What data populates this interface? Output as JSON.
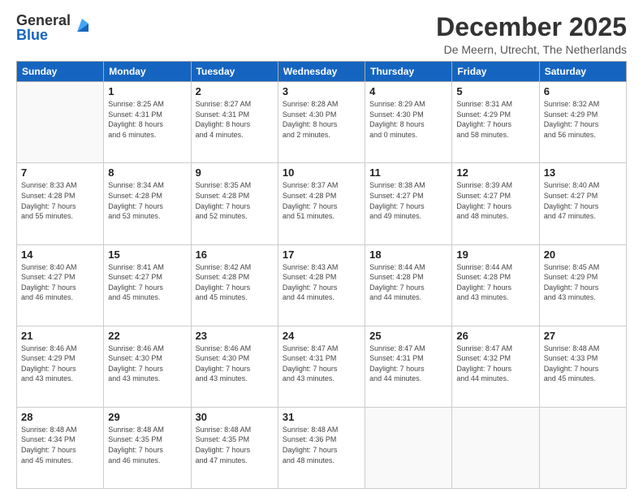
{
  "logo": {
    "general": "General",
    "blue": "Blue"
  },
  "title": "December 2025",
  "subtitle": "De Meern, Utrecht, The Netherlands",
  "days_of_week": [
    "Sunday",
    "Monday",
    "Tuesday",
    "Wednesday",
    "Thursday",
    "Friday",
    "Saturday"
  ],
  "weeks": [
    [
      {
        "day": "",
        "info": ""
      },
      {
        "day": "1",
        "info": "Sunrise: 8:25 AM\nSunset: 4:31 PM\nDaylight: 8 hours\nand 6 minutes."
      },
      {
        "day": "2",
        "info": "Sunrise: 8:27 AM\nSunset: 4:31 PM\nDaylight: 8 hours\nand 4 minutes."
      },
      {
        "day": "3",
        "info": "Sunrise: 8:28 AM\nSunset: 4:30 PM\nDaylight: 8 hours\nand 2 minutes."
      },
      {
        "day": "4",
        "info": "Sunrise: 8:29 AM\nSunset: 4:30 PM\nDaylight: 8 hours\nand 0 minutes."
      },
      {
        "day": "5",
        "info": "Sunrise: 8:31 AM\nSunset: 4:29 PM\nDaylight: 7 hours\nand 58 minutes."
      },
      {
        "day": "6",
        "info": "Sunrise: 8:32 AM\nSunset: 4:29 PM\nDaylight: 7 hours\nand 56 minutes."
      }
    ],
    [
      {
        "day": "7",
        "info": "Sunrise: 8:33 AM\nSunset: 4:28 PM\nDaylight: 7 hours\nand 55 minutes."
      },
      {
        "day": "8",
        "info": "Sunrise: 8:34 AM\nSunset: 4:28 PM\nDaylight: 7 hours\nand 53 minutes."
      },
      {
        "day": "9",
        "info": "Sunrise: 8:35 AM\nSunset: 4:28 PM\nDaylight: 7 hours\nand 52 minutes."
      },
      {
        "day": "10",
        "info": "Sunrise: 8:37 AM\nSunset: 4:28 PM\nDaylight: 7 hours\nand 51 minutes."
      },
      {
        "day": "11",
        "info": "Sunrise: 8:38 AM\nSunset: 4:27 PM\nDaylight: 7 hours\nand 49 minutes."
      },
      {
        "day": "12",
        "info": "Sunrise: 8:39 AM\nSunset: 4:27 PM\nDaylight: 7 hours\nand 48 minutes."
      },
      {
        "day": "13",
        "info": "Sunrise: 8:40 AM\nSunset: 4:27 PM\nDaylight: 7 hours\nand 47 minutes."
      }
    ],
    [
      {
        "day": "14",
        "info": "Sunrise: 8:40 AM\nSunset: 4:27 PM\nDaylight: 7 hours\nand 46 minutes."
      },
      {
        "day": "15",
        "info": "Sunrise: 8:41 AM\nSunset: 4:27 PM\nDaylight: 7 hours\nand 45 minutes."
      },
      {
        "day": "16",
        "info": "Sunrise: 8:42 AM\nSunset: 4:28 PM\nDaylight: 7 hours\nand 45 minutes."
      },
      {
        "day": "17",
        "info": "Sunrise: 8:43 AM\nSunset: 4:28 PM\nDaylight: 7 hours\nand 44 minutes."
      },
      {
        "day": "18",
        "info": "Sunrise: 8:44 AM\nSunset: 4:28 PM\nDaylight: 7 hours\nand 44 minutes."
      },
      {
        "day": "19",
        "info": "Sunrise: 8:44 AM\nSunset: 4:28 PM\nDaylight: 7 hours\nand 43 minutes."
      },
      {
        "day": "20",
        "info": "Sunrise: 8:45 AM\nSunset: 4:29 PM\nDaylight: 7 hours\nand 43 minutes."
      }
    ],
    [
      {
        "day": "21",
        "info": "Sunrise: 8:46 AM\nSunset: 4:29 PM\nDaylight: 7 hours\nand 43 minutes."
      },
      {
        "day": "22",
        "info": "Sunrise: 8:46 AM\nSunset: 4:30 PM\nDaylight: 7 hours\nand 43 minutes."
      },
      {
        "day": "23",
        "info": "Sunrise: 8:46 AM\nSunset: 4:30 PM\nDaylight: 7 hours\nand 43 minutes."
      },
      {
        "day": "24",
        "info": "Sunrise: 8:47 AM\nSunset: 4:31 PM\nDaylight: 7 hours\nand 43 minutes."
      },
      {
        "day": "25",
        "info": "Sunrise: 8:47 AM\nSunset: 4:31 PM\nDaylight: 7 hours\nand 44 minutes."
      },
      {
        "day": "26",
        "info": "Sunrise: 8:47 AM\nSunset: 4:32 PM\nDaylight: 7 hours\nand 44 minutes."
      },
      {
        "day": "27",
        "info": "Sunrise: 8:48 AM\nSunset: 4:33 PM\nDaylight: 7 hours\nand 45 minutes."
      }
    ],
    [
      {
        "day": "28",
        "info": "Sunrise: 8:48 AM\nSunset: 4:34 PM\nDaylight: 7 hours\nand 45 minutes."
      },
      {
        "day": "29",
        "info": "Sunrise: 8:48 AM\nSunset: 4:35 PM\nDaylight: 7 hours\nand 46 minutes."
      },
      {
        "day": "30",
        "info": "Sunrise: 8:48 AM\nSunset: 4:35 PM\nDaylight: 7 hours\nand 47 minutes."
      },
      {
        "day": "31",
        "info": "Sunrise: 8:48 AM\nSunset: 4:36 PM\nDaylight: 7 hours\nand 48 minutes."
      },
      {
        "day": "",
        "info": ""
      },
      {
        "day": "",
        "info": ""
      },
      {
        "day": "",
        "info": ""
      }
    ]
  ]
}
